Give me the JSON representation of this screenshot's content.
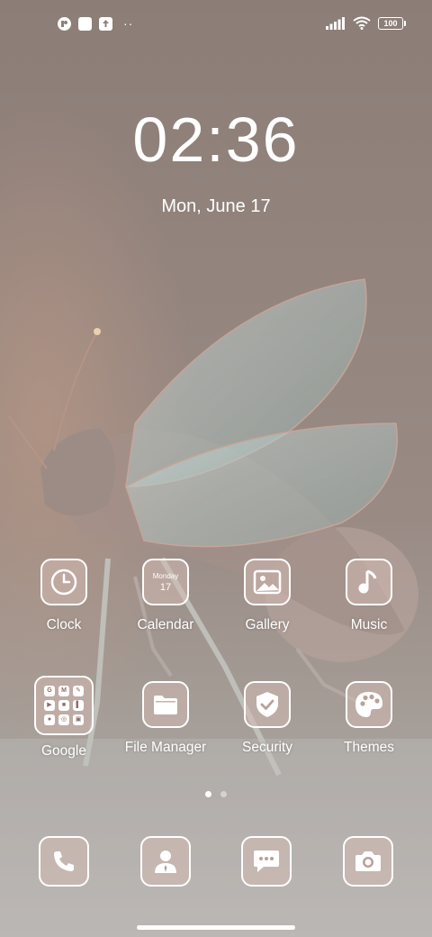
{
  "status_bar": {
    "icons": [
      "app-notification-icon",
      "square-notification-icon",
      "upload-notification-icon"
    ],
    "more_dots": "··",
    "battery": "100",
    "signal_icon": "cellular-signal-icon",
    "wifi_icon": "wifi-icon"
  },
  "lockclock": {
    "time": "02:36",
    "date": "Mon, June 17"
  },
  "calendar_icon": {
    "day": "Monday",
    "num": "17"
  },
  "apps_row1": [
    {
      "label": "Clock",
      "icon": "clock-icon"
    },
    {
      "label": "Calendar",
      "icon": "calendar-icon"
    },
    {
      "label": "Gallery",
      "icon": "gallery-icon"
    },
    {
      "label": "Music",
      "icon": "music-icon"
    }
  ],
  "apps_row2": [
    {
      "label": "Google",
      "icon": "folder-icon"
    },
    {
      "label": "File Manager",
      "icon": "file-manager-icon"
    },
    {
      "label": "Security",
      "icon": "shield-icon"
    },
    {
      "label": "Themes",
      "icon": "palette-icon"
    }
  ],
  "google_folder_icons": [
    "G",
    "M",
    "✎",
    "▶",
    "■",
    "▌",
    "●",
    "◎",
    "▣"
  ],
  "dock": [
    {
      "icon": "phone-icon"
    },
    {
      "icon": "contacts-icon"
    },
    {
      "icon": "messages-icon"
    },
    {
      "icon": "camera-icon"
    }
  ],
  "page_indicator": {
    "pages": 2,
    "current": 1
  },
  "colors": {
    "icon_fill": "#d2b9b2",
    "wallpaper_base": "#8f7f79"
  }
}
